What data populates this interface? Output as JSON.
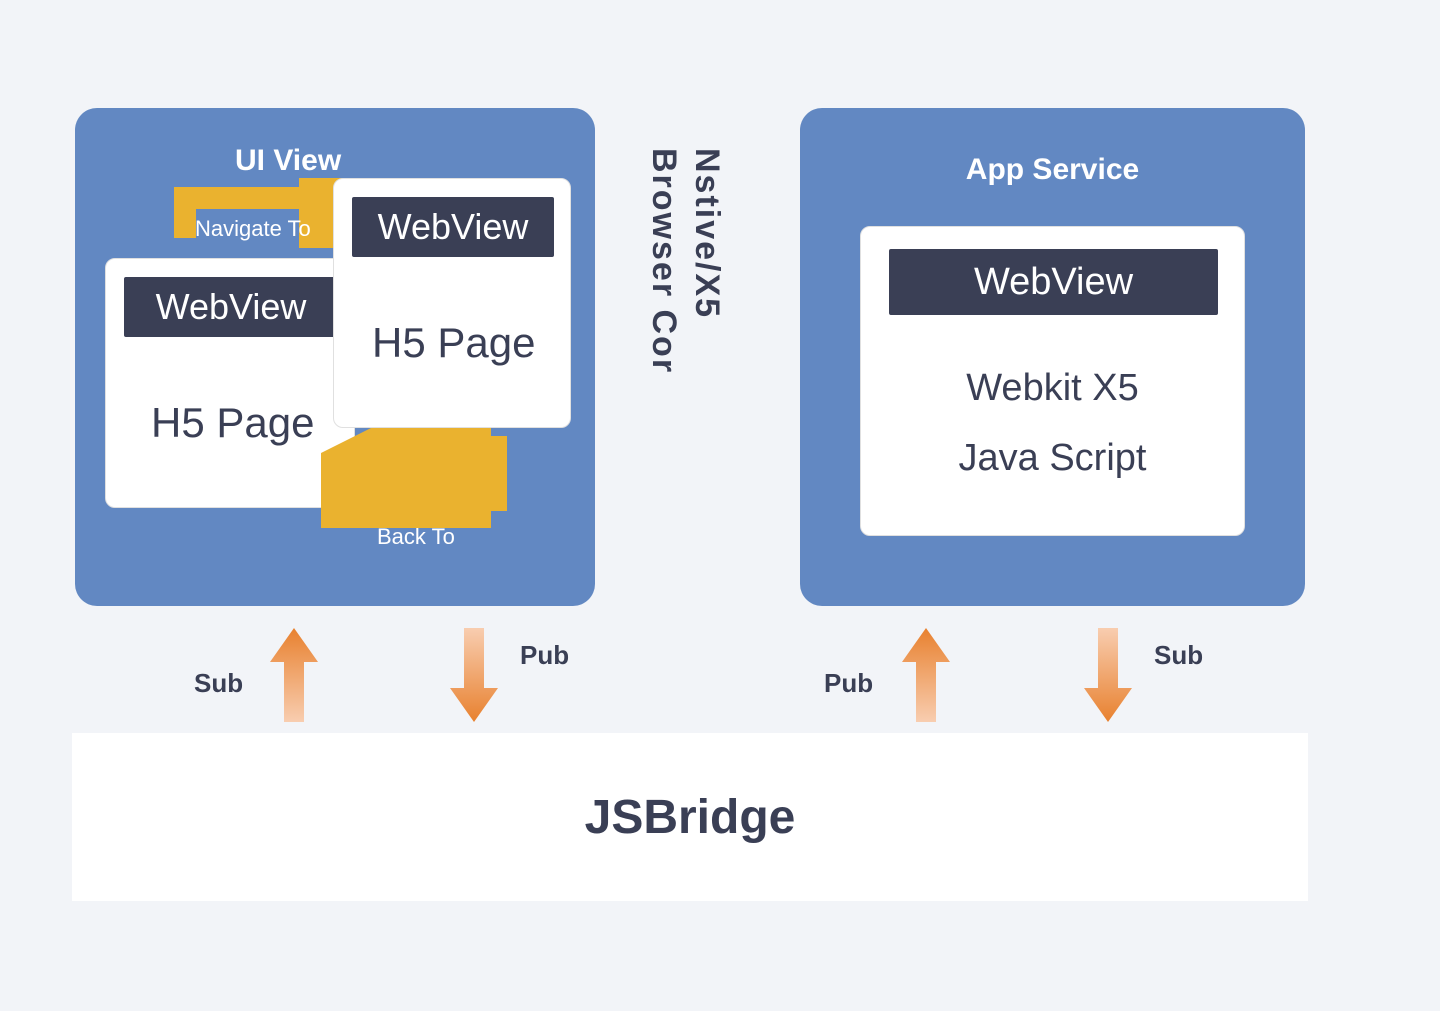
{
  "ui_view": {
    "title": "UI View",
    "navigate_label": "Navigate To",
    "back_label": "Back To",
    "card1": {
      "webview": "WebView",
      "page": "H5 Page"
    },
    "card2": {
      "webview": "WebView",
      "page": "H5 Page"
    }
  },
  "app_service": {
    "title": "App Service",
    "webview": "WebView",
    "engine_line": "Webkit   X5",
    "js_line": "Java Script"
  },
  "center_label": {
    "line1": "Nstive/X5",
    "line2": "Browser Cor"
  },
  "pubsub": {
    "left_sub": "Sub",
    "left_pub": "Pub",
    "right_pub": "Pub",
    "right_sub": "Sub"
  },
  "jsbridge": "JSBridge"
}
